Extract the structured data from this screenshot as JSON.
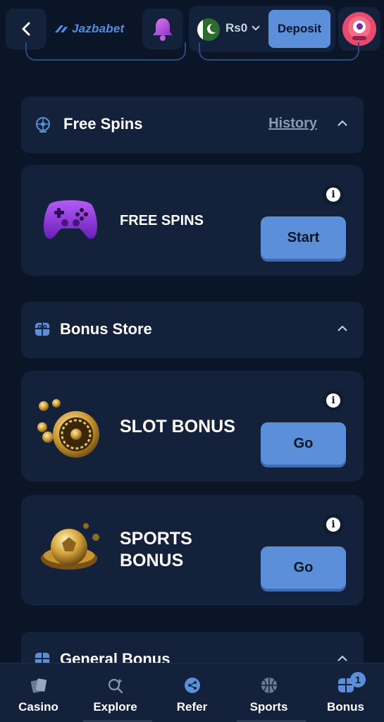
{
  "header": {
    "logo_text": "Jazbabet",
    "balance": "Rs0",
    "deposit_label": "Deposit"
  },
  "free_spins_section": {
    "title": "Free Spins",
    "history_label": "History"
  },
  "free_spins_card": {
    "title": "FREE SPINS",
    "button_label": "Start"
  },
  "bonus_store_section": {
    "title": "Bonus Store"
  },
  "slot_bonus_card": {
    "title": "SLOT BONUS",
    "button_label": "Go"
  },
  "sports_bonus_card": {
    "title_line1": "SPORTS",
    "title_line2": "BONUS",
    "button_label": "Go"
  },
  "general_bonus_section": {
    "title": "General Bonus"
  },
  "bottom_nav": {
    "items": [
      {
        "label": "Casino",
        "icon": "cards-icon"
      },
      {
        "label": "Explore",
        "icon": "explore-search-icon"
      },
      {
        "label": "Refer",
        "icon": "share-icon"
      },
      {
        "label": "Sports",
        "icon": "basketball-icon"
      },
      {
        "label": "Bonus",
        "icon": "gift-icon",
        "badge": "1"
      }
    ]
  },
  "colors": {
    "background": "#0a1628",
    "panel": "#14213a",
    "accent": "#5b8fd9"
  }
}
